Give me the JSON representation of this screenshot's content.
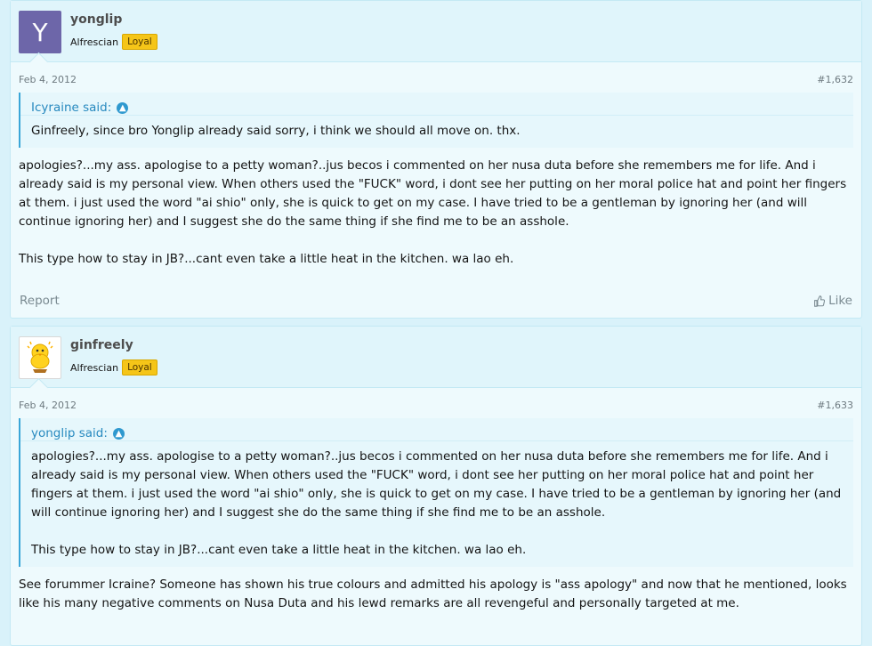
{
  "posts": [
    {
      "username": "yonglip",
      "avatar_letter": "Y",
      "avatar_color": "#6d66a9",
      "user_title": "Alfrescian",
      "badge": "Loyal",
      "date": "Feb 4, 2012",
      "post_number": "#1,632",
      "quote": {
        "author_line": "Icyraine said:",
        "paragraphs": [
          "Ginfreely, since bro Yonglip already said sorry, i think we should all move on. thx."
        ]
      },
      "paragraphs": [
        "apologies?...my ass. apologise to a petty woman?..jus becos i commented on her nusa duta before she remembers me for life. And i already said is my personal view. When others used the \"FUCK\" word, i dont see her putting on her moral police hat and point her fingers at them. i just used the word \"ai shio\" only, she is quick to get on my case. I have tried to be a gentleman by ignoring her (and will continue ignoring her) and I suggest she do the same thing if she find me to be an asshole.",
        "This type how to stay in JB?...cant even take a little heat in the kitchen. wa lao eh."
      ],
      "report_label": "Report",
      "like_label": "Like"
    },
    {
      "username": "ginfreely",
      "avatar_icon": "chick-avatar-icon",
      "user_title": "Alfrescian",
      "badge": "Loyal",
      "date": "Feb 4, 2012",
      "post_number": "#1,633",
      "quote": {
        "author_line": "yonglip said:",
        "paragraphs": [
          "apologies?...my ass. apologise to a petty woman?..jus becos i commented on her nusa duta before she remembers me for life. And i already said is my personal view. When others used the \"FUCK\" word, i dont see her putting on her moral police hat and point her fingers at them. i just used the word \"ai shio\" only, she is quick to get on my case. I have tried to be a gentleman by ignoring her (and will continue ignoring her) and I suggest she do the same thing if she find me to be an asshole.",
          "This type how to stay in JB?...cant even take a little heat in the kitchen. wa lao eh."
        ]
      },
      "paragraphs": [
        "See forummer Icraine? Someone has shown his true colours and admitted his apology is \"ass apology\" and now that he mentioned, looks like his many negative comments on Nusa Duta and his lewd remarks are all revengeful and personally targeted at me."
      ]
    }
  ],
  "colors": {
    "accent": "#2789bf",
    "badge": "#f5c518",
    "background": "#d9f2fa"
  }
}
